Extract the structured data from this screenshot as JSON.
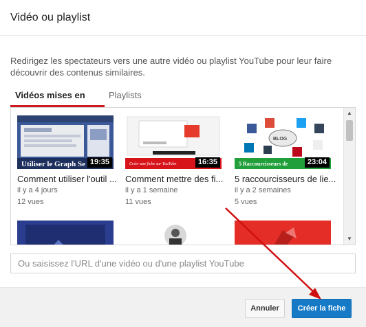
{
  "dialog": {
    "title": "Vidéo ou playlist",
    "description": "Redirigez les spectateurs vers une autre vidéo ou playlist YouTube pour leur faire découvrir des contenus similaires."
  },
  "tabs": {
    "uploads": "Vidéos mises en ligne",
    "playlists": "Playlists"
  },
  "videos": [
    {
      "title": "Comment utiliser l'outil ...",
      "date": "il y a 4 jours",
      "views": "12 vues",
      "duration": "19:35",
      "thumb_caption": "Utiliser le Graph Se"
    },
    {
      "title": "Comment mettre des fi...",
      "date": "il y a 1 semaine",
      "views": "11 vues",
      "duration": "16:35",
      "thumb_caption": "Créer une fiche sur YouTube"
    },
    {
      "title": "5 raccourcisseurs de lie...",
      "date": "il y a 2 semaines",
      "views": "5 vues",
      "duration": "23:04",
      "thumb_caption": "5 Raccourcisseurs de",
      "thumb_badge": "BLOG"
    }
  ],
  "url_input": {
    "placeholder": "Ou saisissez l'URL d'une vidéo ou d'une playlist YouTube",
    "value": ""
  },
  "buttons": {
    "cancel": "Annuler",
    "create": "Créer la fiche"
  },
  "colors": {
    "accent_red": "#cc181e",
    "primary_blue": "#167ac6",
    "arrow_red": "#d01010"
  },
  "icons": [
    "scroll-up-arrow-icon",
    "scroll-down-arrow-icon"
  ]
}
